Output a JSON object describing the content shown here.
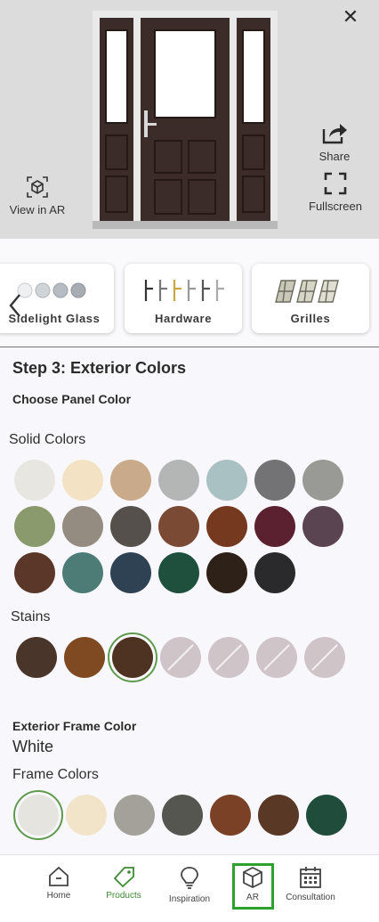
{
  "preview": {
    "close_glyph": "✕",
    "view_in_ar_label": "View in AR",
    "share_label": "Share",
    "fullscreen_label": "Fullscreen",
    "door_color": "#3b2c2a"
  },
  "carousel": {
    "categories": [
      {
        "label": "Sidelight Glass",
        "icon": "glass-beads-icon"
      },
      {
        "label": "Hardware",
        "icon": "door-handles-icon"
      },
      {
        "label": "Grilles",
        "icon": "grille-panes-icon"
      }
    ]
  },
  "content": {
    "step_title": "Step 3: Exterior Colors",
    "panel_title": "Choose Panel Color",
    "solid_label": "Solid Colors",
    "solid_colors": [
      "#e8e6e1",
      "#f3e3c4",
      "#c9ab8c",
      "#b4b5b5",
      "#a9c1c2",
      "#737275",
      "#999a95",
      "#8b9a6c",
      "#948b81",
      "#55504b",
      "#7a4a35",
      "#74391f",
      "#5c2131",
      "#5b4452",
      "#5a3728",
      "#4d7c76",
      "#2f4254",
      "#1f4f3d",
      "#2e2118",
      "#2a2a2c"
    ],
    "stains_label": "Stains",
    "stains": [
      {
        "color": "#4a352a",
        "state": "available"
      },
      {
        "color": "#7f4a22",
        "state": "available"
      },
      {
        "color": "#4e3322",
        "state": "selected"
      },
      {
        "color": "#cfc4c8",
        "state": "unavailable"
      },
      {
        "color": "#cfc4c8",
        "state": "unavailable"
      },
      {
        "color": "#cfc4c8",
        "state": "unavailable"
      },
      {
        "color": "#cfc4c8",
        "state": "unavailable"
      }
    ],
    "frame_heading": "Exterior Frame Color",
    "frame_value": "White",
    "frame_colors_label": "Frame Colors",
    "frame_colors": [
      {
        "color": "#e6e4df",
        "selected": true
      },
      {
        "color": "#f1e4c9",
        "selected": false
      },
      {
        "color": "#a3a19a",
        "selected": false
      },
      {
        "color": "#555650",
        "selected": false
      },
      {
        "color": "#7b4126",
        "selected": false
      },
      {
        "color": "#5a3826",
        "selected": false
      },
      {
        "color": "#1f4c3b",
        "selected": false
      }
    ]
  },
  "tabbar": {
    "tabs": [
      {
        "label": "Home",
        "icon": "home-icon"
      },
      {
        "label": "Products",
        "icon": "tag-icon"
      },
      {
        "label": "Inspiration",
        "icon": "lightbulb-icon"
      },
      {
        "label": "AR",
        "icon": "cube-icon"
      },
      {
        "label": "Consultation",
        "icon": "calendar-icon"
      }
    ],
    "active_tab": "Products",
    "accent": "#3e8a32"
  }
}
